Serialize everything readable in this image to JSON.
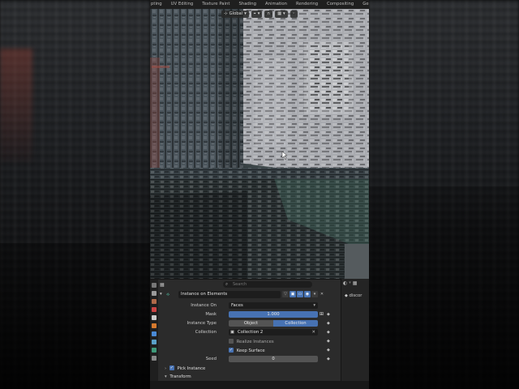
{
  "topbar": {
    "tabs": [
      "pting",
      "UV Editing",
      "Texture Paint",
      "Shading",
      "Animation",
      "Rendering",
      "Compositing",
      "Geometry Nodes"
    ]
  },
  "viewport": {
    "orientation": "Global"
  },
  "properties": {
    "search_placeholder": "Search",
    "node_name": "Instance on Elements",
    "instance_on": {
      "label": "Instance On",
      "value": "Faces"
    },
    "mask": {
      "label": "Mask",
      "value": "1.000"
    },
    "instance_type": {
      "label": "Instance Type",
      "options": [
        "Object",
        "Collection"
      ],
      "selected": "Collection"
    },
    "collection": {
      "label": "Collection",
      "value": "Collection 2"
    },
    "realize_instances": {
      "label": "Realize Instances",
      "checked": false
    },
    "keep_surface": {
      "label": "Keep Surface",
      "checked": true
    },
    "seed": {
      "label": "Seed",
      "value": "0"
    },
    "pick_instance": {
      "label": "Pick Instance",
      "checked": true
    },
    "transform": {
      "label": "Transform"
    }
  },
  "outliner": {
    "item_label": "discor"
  },
  "colors": {
    "accent_blue": "#4772b3",
    "panel_bg": "#2b2b2b",
    "field_bg": "#545454"
  }
}
